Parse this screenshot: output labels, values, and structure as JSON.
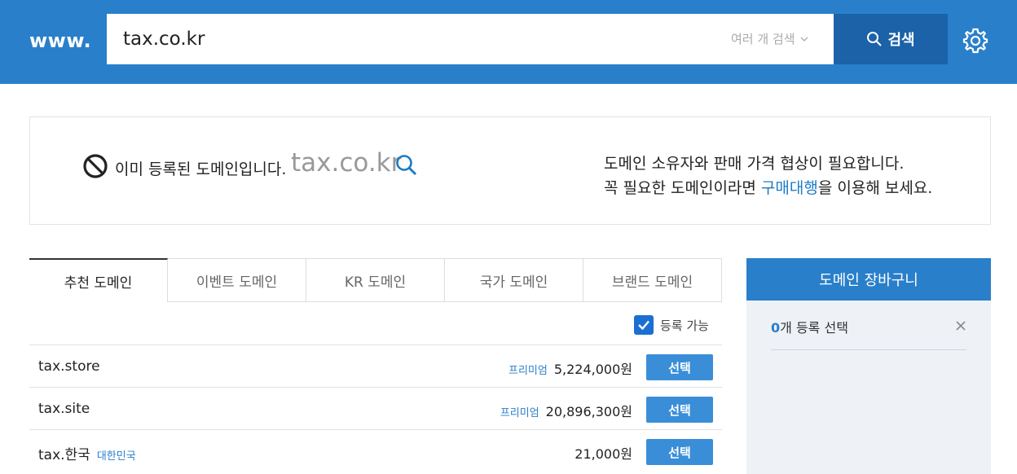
{
  "header": {
    "logo": "www.",
    "search_value": "tax.co.kr",
    "multi_search_label": "여러 개 검색",
    "search_button_label": "검색",
    "colors": {
      "bar": "#2a7fca",
      "button": "#1b62a8"
    }
  },
  "notice": {
    "status_text": "이미 등록된 도메인입니다.",
    "domain": "tax.co.kr",
    "line1": "도메인 소유자와 판매 가격 협상이 필요합니다.",
    "line2_prefix": "꼭 필요한 도메인이라면 ",
    "line2_link": "구매대행",
    "line2_suffix": "을 이용해 보세요."
  },
  "tabs": [
    {
      "label": "추천 도메인",
      "active": true
    },
    {
      "label": "이벤트 도메인",
      "active": false
    },
    {
      "label": "KR 도메인",
      "active": false
    },
    {
      "label": "국가 도메인",
      "active": false
    },
    {
      "label": "브랜드 도메인",
      "active": false
    }
  ],
  "filter": {
    "available_label": "등록 가능",
    "checked": true
  },
  "rows": [
    {
      "domain": "tax.store",
      "tag": "",
      "premium": "프리미엄",
      "price": "5,224,000원",
      "button": "선택"
    },
    {
      "domain": "tax.site",
      "tag": "",
      "premium": "프리미엄",
      "price": "20,896,300원",
      "button": "선택"
    },
    {
      "domain": "tax.한국",
      "tag": "대한민국",
      "premium": "",
      "price": "21,000원",
      "button": "선택"
    }
  ],
  "cart": {
    "title": "도메인 장바구니",
    "count": "0",
    "count_suffix": "개 등록 선택"
  }
}
